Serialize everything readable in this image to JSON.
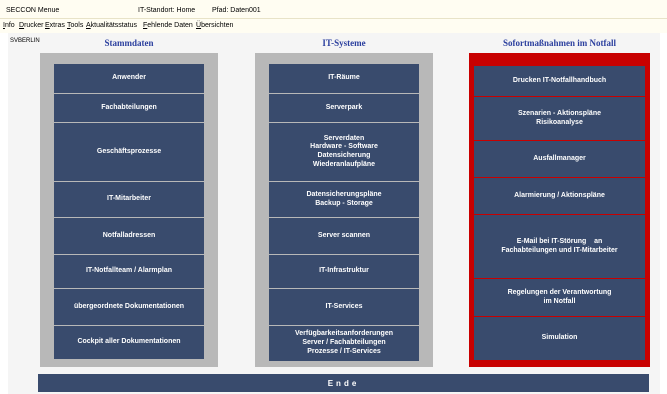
{
  "titlebar": {
    "app": "SECCON Menue",
    "standort": "IT-Standort: Home",
    "pfad": "Pfad: Daten001"
  },
  "menu": [
    "Info",
    "Drucker",
    "Extras",
    "Tools",
    "Aktualitätsstatus",
    "Fehlende Daten",
    "Übersichten"
  ],
  "user": "SVBERLIN",
  "columns": {
    "stammdaten": {
      "title": "Stammdaten",
      "buttons": [
        "Anwender",
        "Fachabteilungen",
        "Geschäftsprozesse",
        "IT-Mitarbeiter",
        "Notfalladressen",
        "IT-Notfallteam / Alarmplan",
        "übergeordnete Dokumentationen",
        "Cockpit aller Dokumentationen"
      ]
    },
    "itsysteme": {
      "title": "IT-Systeme",
      "buttons": [
        "IT-Räume",
        "Serverpark",
        "Serverdaten\nHardware - Software\nDatensicherung\nWiederanlaufpläne",
        "Datensicherungspläne\nBackup - Storage",
        "Server scannen",
        "IT-Infrastruktur",
        "IT-Services",
        "Verfügbarkeitsanforderungen\nServer / Fachabteilungen\nProzesse / IT-Services"
      ]
    },
    "notfall": {
      "title": "Sofortmaßnahmen im Notfall",
      "buttons": [
        "Drucken IT-Notfallhandbuch",
        "Szenarien - Aktionspläne\nRisikoanalyse",
        "Ausfallmanager",
        "Alarmierung / Aktionspläne",
        "E-Mail bei IT-Störung    an\nFachabteilungen und IT-Mitarbeiter",
        "Regelungen der Verantwortung\nim Notfall",
        "Simulation"
      ]
    }
  },
  "ende": "Ende",
  "colors": {
    "button": "#394b6d",
    "panel_gray": "#b8b8b8",
    "panel_red": "#c80000",
    "header_blue": "#2b3f9e"
  }
}
